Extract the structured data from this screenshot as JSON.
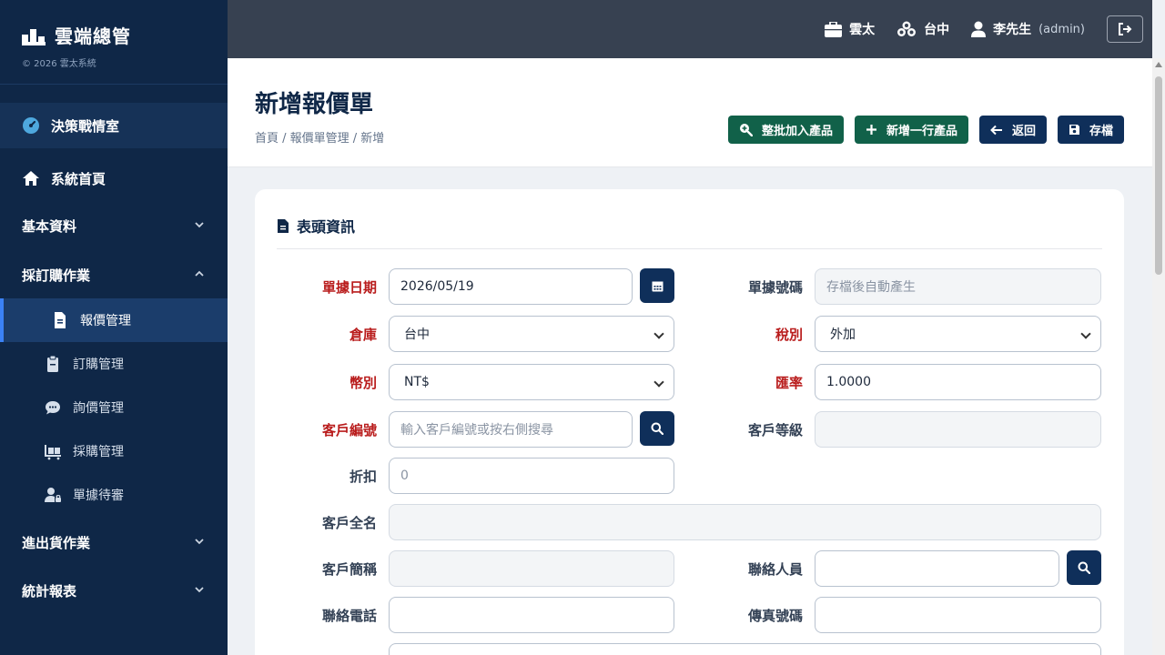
{
  "brand": {
    "title": "雲端總管",
    "subtitle": "© 2026 雲太系統"
  },
  "sidebar": {
    "dashboard": "決策戰情室",
    "items": [
      {
        "label": "系統首頁"
      },
      {
        "label": "基本資料"
      },
      {
        "label": "採訂購作業"
      },
      {
        "label": "進出貨作業"
      },
      {
        "label": "統計報表"
      }
    ],
    "sub_items": [
      {
        "label": "報價管理"
      },
      {
        "label": "訂購管理"
      },
      {
        "label": "詢價管理"
      },
      {
        "label": "採購管理"
      },
      {
        "label": "單據待審"
      }
    ]
  },
  "topbar": {
    "company": "雲太",
    "branch": "台中",
    "user": "李先生",
    "role": "(admin)"
  },
  "page": {
    "title": "新增報價單",
    "breadcrumb": "首頁 / 報價單管理 / 新增"
  },
  "actions": {
    "batch_add": "整批加入產品",
    "add_row": "新增一行產品",
    "back": "返回",
    "save": "存檔"
  },
  "form": {
    "section_title": "表頭資訊",
    "date_label": "單據日期",
    "date_value": "2026/05/19",
    "doc_no_label": "單據號碼",
    "doc_no_placeholder": "存檔後自動產生",
    "warehouse_label": "倉庫",
    "warehouse_value": "台中",
    "tax_label": "稅別",
    "tax_value": "外加",
    "currency_label": "幣別",
    "currency_value": "NT$",
    "rate_label": "匯率",
    "rate_value": "1.0000",
    "customer_no_label": "客戶編號",
    "customer_no_placeholder": "輸入客戶編號或按右側搜尋",
    "customer_level_label": "客戶等級",
    "discount_label": "折扣",
    "discount_placeholder": "0",
    "customer_fullname_label": "客戶全名",
    "customer_shortname_label": "客戶簡稱",
    "contact_label": "聯絡人員",
    "phone_label": "聯絡電話",
    "fax_label": "傳真號碼"
  },
  "colors": {
    "sidebar": "#0f2747",
    "topbar": "#374151",
    "required": "#b91c1c",
    "green_button": "#116149",
    "navy_button": "#0f2f5a"
  }
}
